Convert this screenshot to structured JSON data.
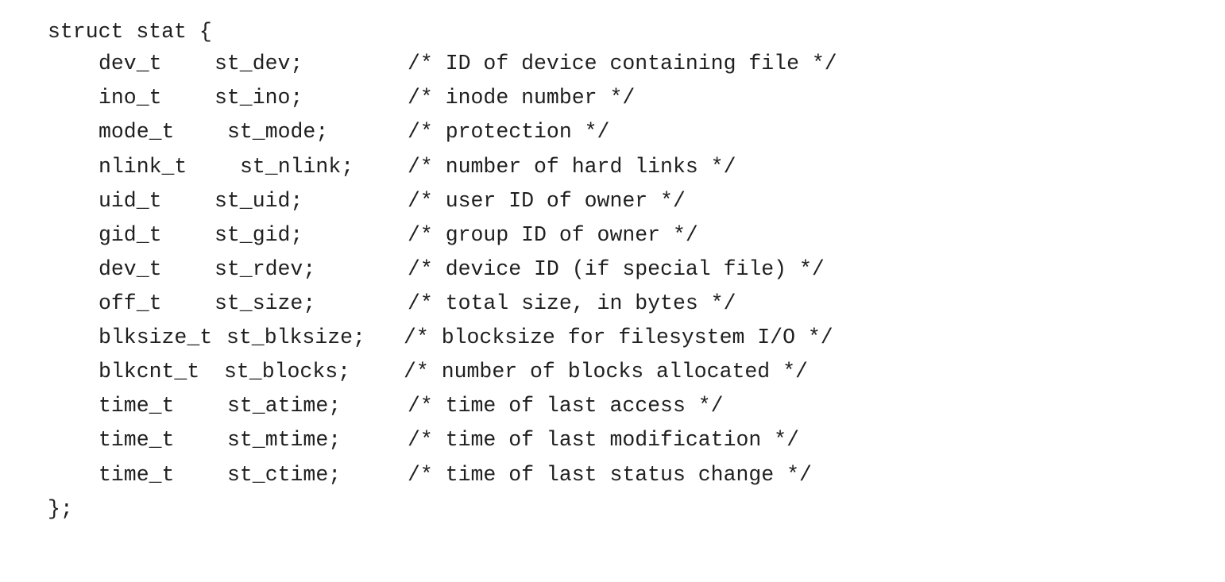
{
  "code": {
    "header": "struct stat {",
    "footer": "};",
    "fields": [
      {
        "type": "dev_t",
        "name": "st_dev;",
        "comment": "/* ID of device containing file */"
      },
      {
        "type": "ino_t",
        "name": "st_ino;",
        "comment": "/* inode number */"
      },
      {
        "type": "mode_t",
        "name": "st_mode;",
        "comment": "/* protection */"
      },
      {
        "type": "nlink_t",
        "name": "st_nlink;",
        "comment": "/* number of hard links */"
      },
      {
        "type": "uid_t",
        "name": "st_uid;",
        "comment": "/* user ID of owner */"
      },
      {
        "type": "gid_t",
        "name": "st_gid;",
        "comment": "/* group ID of owner */"
      },
      {
        "type": "dev_t",
        "name": "st_rdev;",
        "comment": "/* device ID (if special file) */"
      },
      {
        "type": "off_t",
        "name": "st_size;",
        "comment": "/* total size, in bytes */"
      },
      {
        "type": "blksize_t",
        "name": "st_blksize;",
        "comment": "/* blocksize for filesystem I/O */"
      },
      {
        "type": "blkcnt_t",
        "name": "st_blocks;",
        "comment": "/* number of blocks allocated */"
      },
      {
        "type": "time_t",
        "name": "st_atime;",
        "comment": "/* time of last access */"
      },
      {
        "type": "time_t",
        "name": "st_mtime;",
        "comment": "/* time of last modification */"
      },
      {
        "type": "time_t",
        "name": "st_ctime;",
        "comment": "/* time of last status change */"
      }
    ]
  }
}
